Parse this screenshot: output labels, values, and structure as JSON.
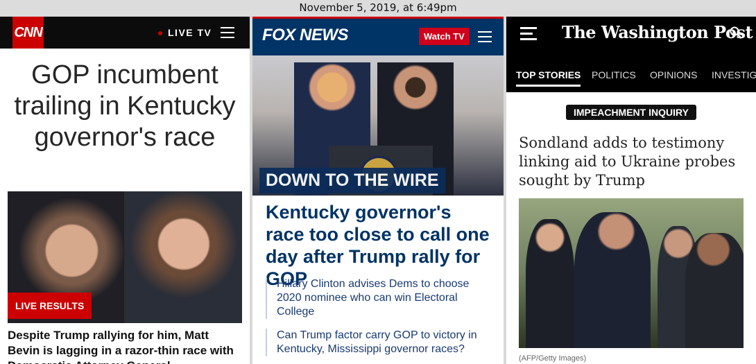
{
  "timestamp": "November 5, 2019, at 6:49pm",
  "cnn": {
    "logo": "CNN",
    "live_tv": "LIVE TV",
    "headline": "GOP incumbent trailing in Kentucky governor's race",
    "badge": "LIVE RESULTS",
    "subhead": "Despite Trump rallying for him, Matt Bevin is lagging in a razor-thin race with Democratic Attorney General"
  },
  "fox": {
    "logo": "FOX NEWS",
    "watch_tv": "Watch TV",
    "banner": "DOWN TO THE WIRE",
    "headline": "Kentucky governor's race too close to call one day after Trump rally for GOP",
    "related": [
      "Hillary Clinton advises Dems to choose 2020 nominee who can win Electoral College",
      "Can Trump factor carry GOP to victory in Kentucky, Mississippi governor races?"
    ]
  },
  "wapo": {
    "logo": "The Washington Post",
    "nav": [
      "TOP STORIES",
      "POLITICS",
      "OPINIONS",
      "INVESTIGA"
    ],
    "kicker": "IMPEACHMENT INQUIRY",
    "headline": "Sondland adds to testimony linking aid to Ukraine probes sought by Trump",
    "credit": "(AFP/Getty Images)"
  }
}
